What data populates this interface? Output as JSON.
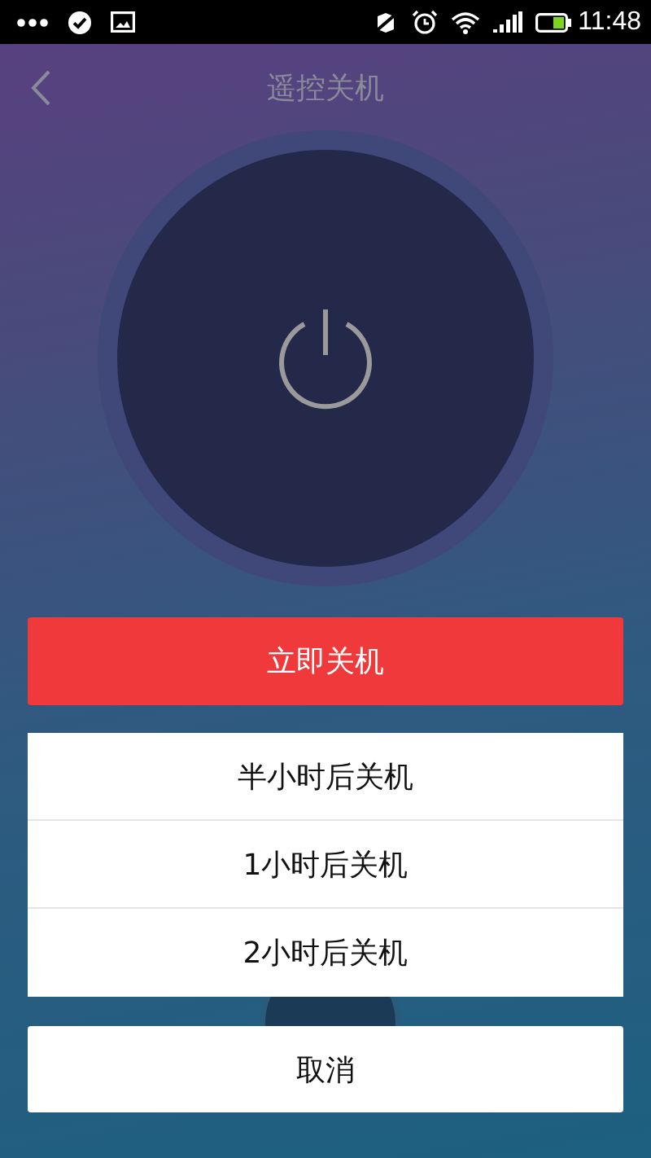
{
  "status_bar": {
    "time": "11:48"
  },
  "header": {
    "title": "遥控关机"
  },
  "action_sheet": {
    "primary": "立即关机",
    "options": [
      "半小时后关机",
      "1小时后关机",
      "2小时后关机"
    ],
    "cancel": "取消"
  }
}
